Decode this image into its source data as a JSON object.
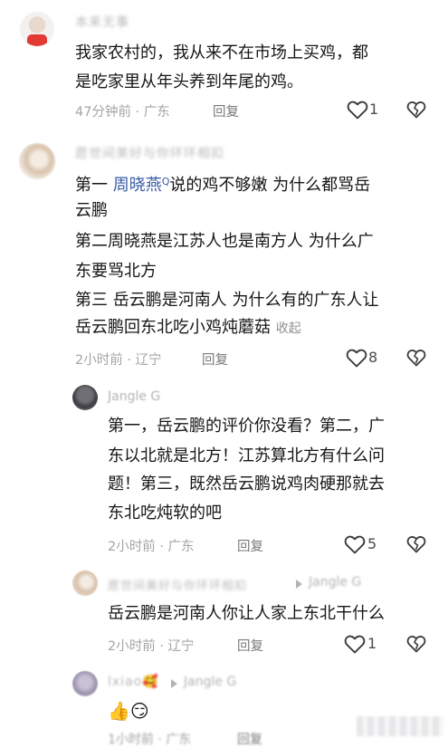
{
  "comments": [
    {
      "author": "本来无事",
      "lines": [
        "我家农村的，我从来不在市场上买鸡，都",
        "是吃家里从年头养到年尾的鸡。"
      ],
      "time": "47分钟前 · 广东",
      "reply_label": "回复",
      "likes": "1"
    },
    {
      "author": "愿世间美好与你环环相扣",
      "line1_prefix": "第一 ",
      "mention": "周晓燕",
      "search_mark": "Q",
      "line1_suffix": "说的鸡不够嫩 为什么都骂岳",
      "lines": [
        "云鹏",
        "第二周晓燕是江苏人也是南方人 为什么广",
        "东要骂北方",
        "第三 岳云鹏是河南人 为什么有的广东人让"
      ],
      "last_line": "岳云鹏回东北吃小鸡炖蘑菇",
      "collapse_label": "收起",
      "time": "2小时前 · 辽宁",
      "reply_label": "回复",
      "likes": "8"
    }
  ],
  "replies": [
    {
      "author": "Jangle G",
      "lines": [
        "第一，岳云鹏的评价你没看？第二，广",
        "东以北就是北方！江苏算北方有什么问",
        "题！第三，既然岳云鹏说鸡肉硬那就去",
        "东北吃炖软的吧"
      ],
      "time": "2小时前 · 广东",
      "reply_label": "回复",
      "likes": "5"
    },
    {
      "author": "愿世间美好与你环环相扣",
      "reply_to": "Jangle G",
      "lines": [
        "岳云鹏是河南人你让人家上东北干什么"
      ],
      "time": "2小时前 · 辽宁",
      "reply_label": "回复",
      "likes": "1"
    },
    {
      "author": "lxiao🥰",
      "reply_to": "Jangle G",
      "emoji": "👍😏",
      "time": "1小时前 · 广东",
      "reply_label": "回复"
    }
  ]
}
